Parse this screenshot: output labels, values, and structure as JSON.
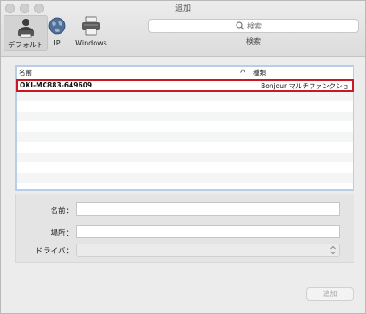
{
  "window": {
    "title": "追加"
  },
  "toolbar": {
    "items": [
      {
        "label": "デフォルト",
        "icon": "user-printer-icon",
        "selected": true
      },
      {
        "label": "IP",
        "icon": "globe-icon",
        "selected": false
      },
      {
        "label": "Windows",
        "icon": "printer-icon",
        "selected": false
      }
    ],
    "search": {
      "placeholder": "検索",
      "caption": "検索"
    }
  },
  "list": {
    "columns": {
      "name": "名前",
      "kind": "種類"
    },
    "rows": [
      {
        "name": "OKI-MC883-649609",
        "kind": "Bonjour マルチファンクショ",
        "selected": true
      }
    ]
  },
  "form": {
    "name_label": "名前：",
    "location_label": "場所：",
    "driver_label": "ドライバ："
  },
  "buttons": {
    "add": "追加"
  },
  "colors": {
    "selection_outline": "#cc1822",
    "list_border": "#b8cde8"
  }
}
